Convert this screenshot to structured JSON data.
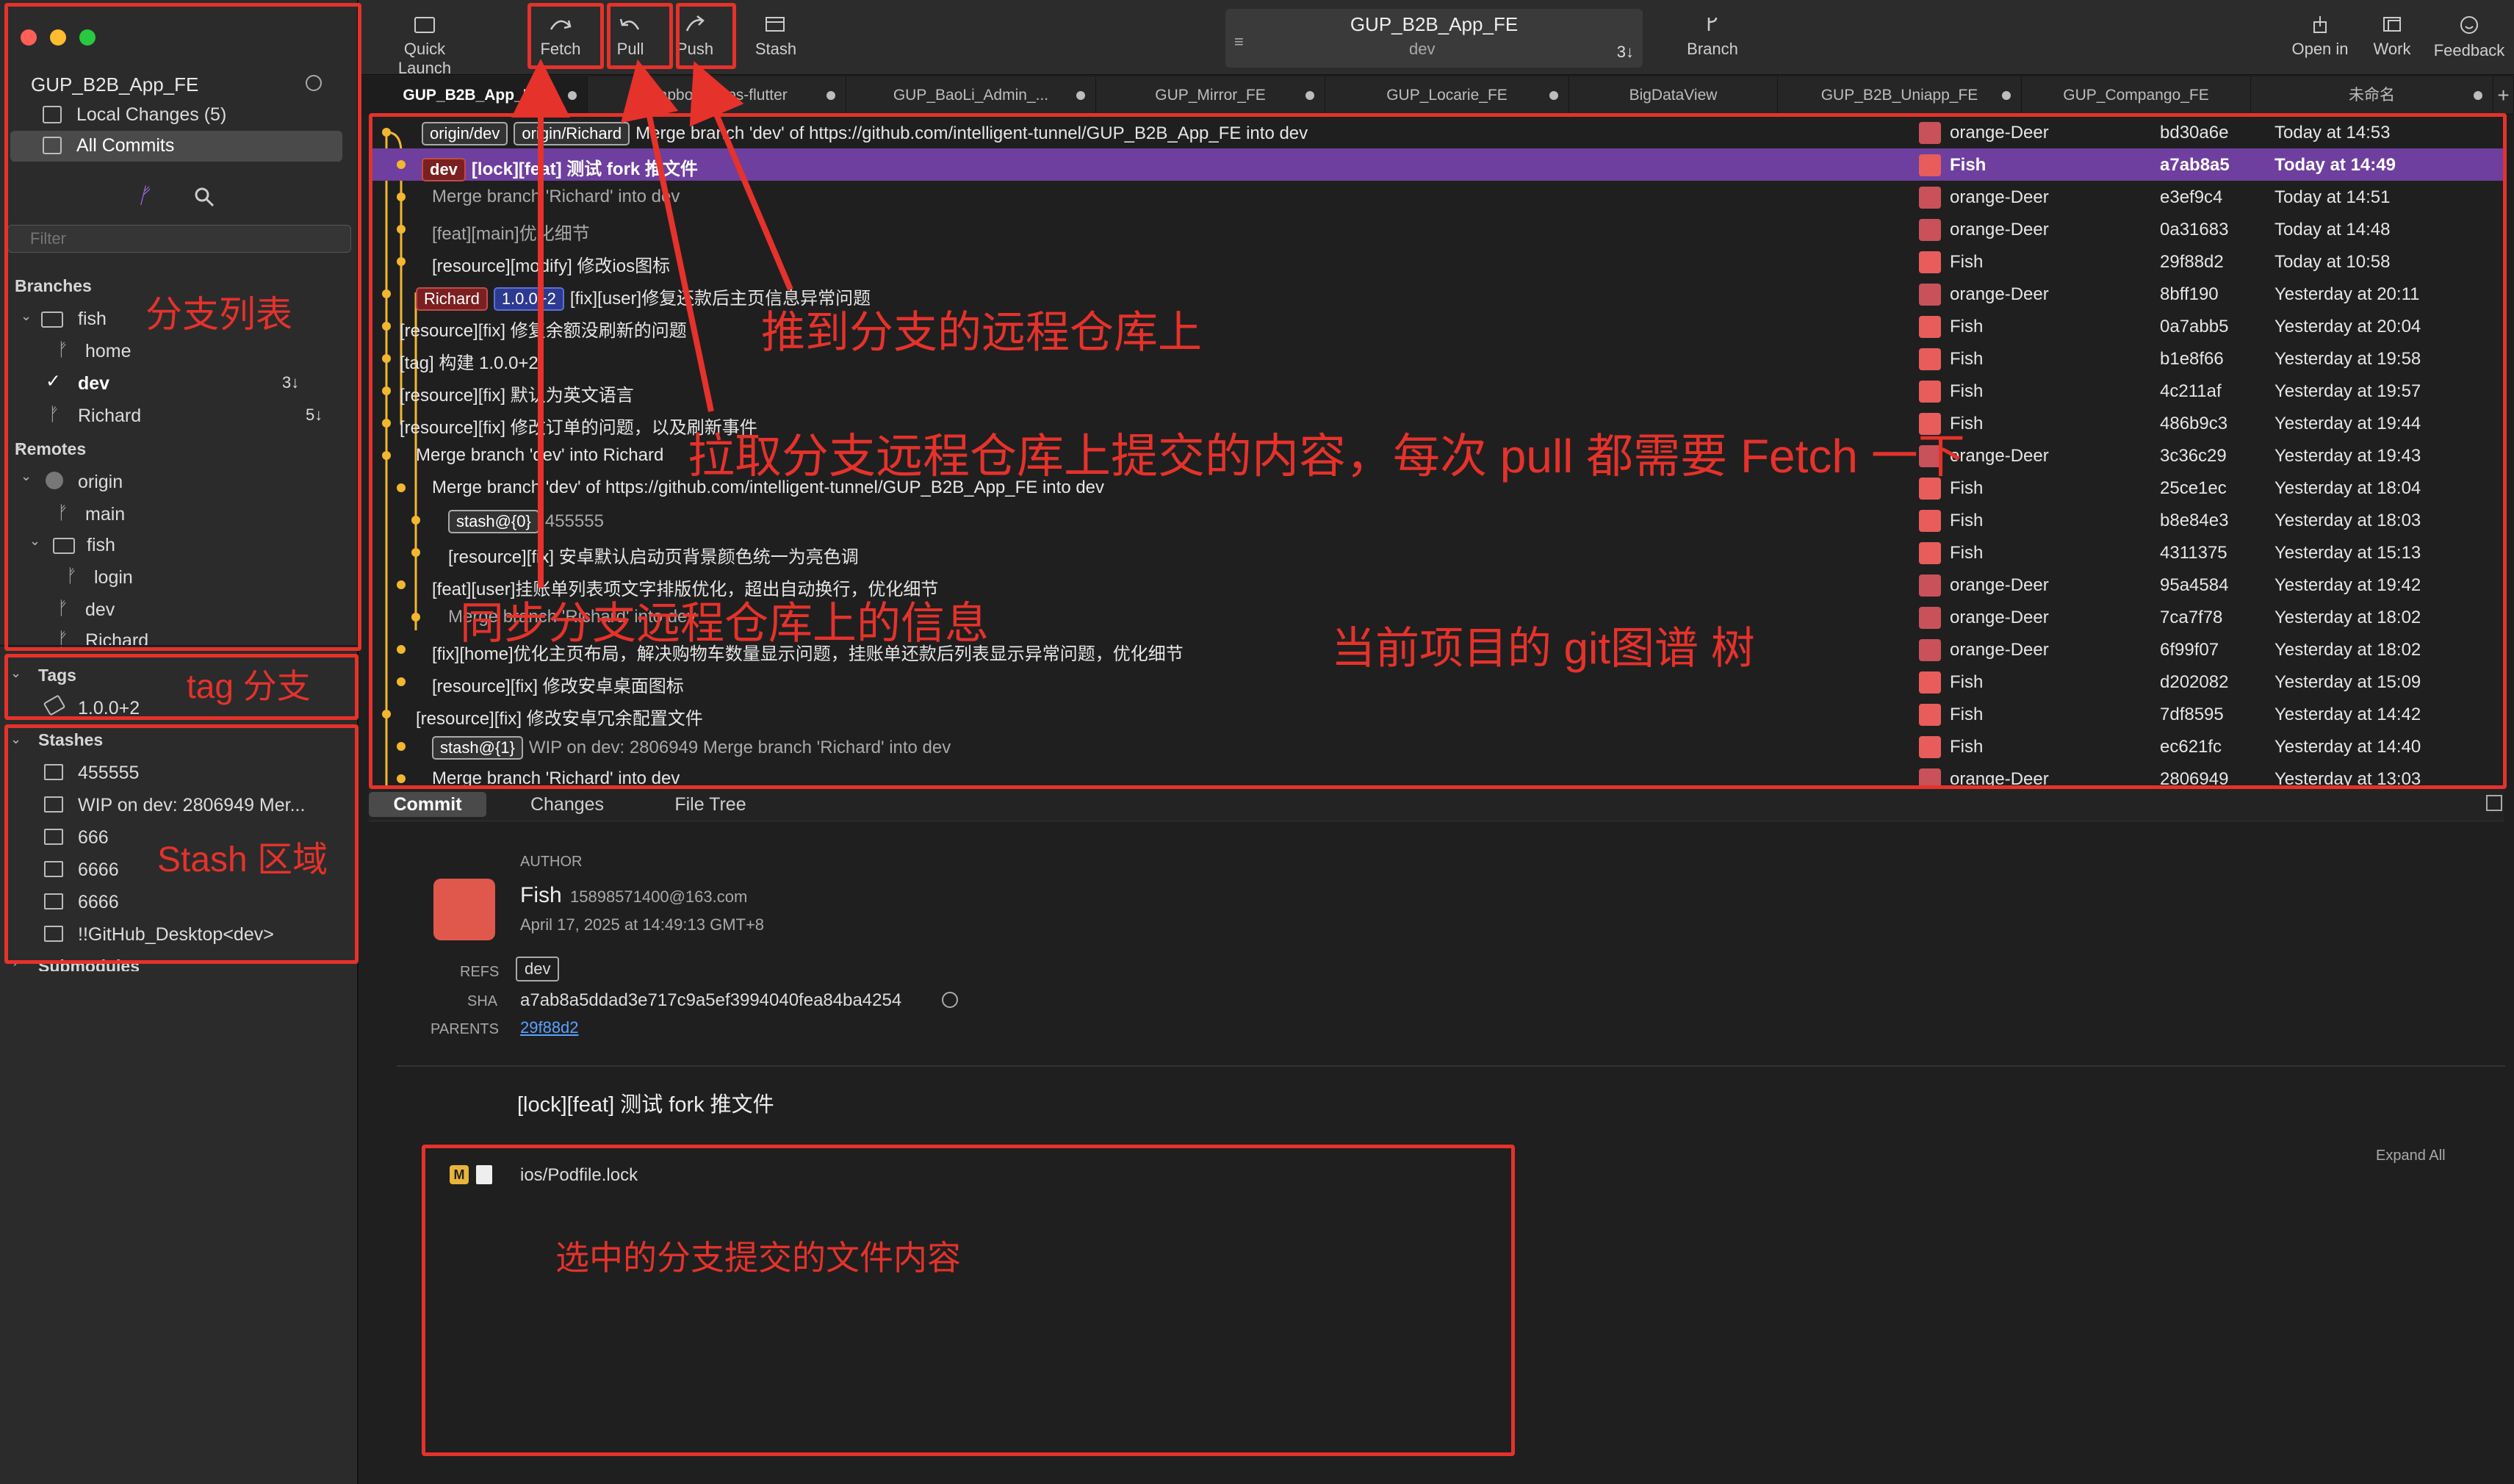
{
  "window": {
    "title": "GUP_B2B_App_FE",
    "branch": "dev",
    "behind": "3↓"
  },
  "toolbar": {
    "quick_launch": "Quick Launch",
    "fetch": "Fetch",
    "pull": "Pull",
    "push": "Push",
    "stash": "Stash",
    "branch": "Branch",
    "open_in": "Open in",
    "work": "Work",
    "feedback": "Feedback"
  },
  "tabs": [
    "GUP_B2B_App_FE",
    "mapbox-maps-flutter",
    "GUP_BaoLi_Admin_...",
    "GUP_Mirror_FE",
    "GUP_Locarie_FE",
    "BigDataView",
    "GUP_B2B_Uniapp_FE",
    "GUP_Compango_FE",
    "未命名"
  ],
  "sidebar": {
    "repo": "GUP_B2B_App_FE",
    "local_changes": "Local Changes (5)",
    "all_commits": "All Commits",
    "filter_placeholder": "Filter",
    "branches_header": "Branches",
    "branches": {
      "folder": "fish",
      "home": "home",
      "dev": "dev",
      "dev_count": "3↓",
      "richard": "Richard",
      "richard_count": "5↓"
    },
    "remotes_header": "Remotes",
    "remotes": {
      "origin": "origin",
      "main": "main",
      "fish": "fish",
      "login": "login",
      "dev": "dev",
      "richard": "Richard"
    },
    "tags_header": "Tags",
    "tags": [
      "1.0.0+2"
    ],
    "stashes_header": "Stashes",
    "stashes": [
      "455555",
      "WIP on dev: 2806949 Mer...",
      "666",
      "6666",
      "6666",
      "!!GitHub_Desktop<dev>"
    ],
    "submodules_header": "Submodules"
  },
  "commits": [
    {
      "refs": [
        "origin/dev",
        "origin/Richard"
      ],
      "message": "Merge branch 'dev' of https://github.com/intelligent-tunnel/GUP_B2B_App_FE into dev",
      "author": "orange-Deer",
      "sha": "bd30a6e",
      "date": "Today at 14:53"
    },
    {
      "refs": [
        "dev"
      ],
      "message": "[lock][feat] 测试 fork 推文件",
      "author": "Fish",
      "sha": "a7ab8a5",
      "date": "Today at 14:49"
    },
    {
      "message": "Merge branch 'Richard' into dev",
      "author": "orange-Deer",
      "sha": "e3ef9c4",
      "date": "Today at 14:51"
    },
    {
      "message": "[feat][main]优化细节",
      "author": "orange-Deer",
      "sha": "0a31683",
      "date": "Today at 14:48"
    },
    {
      "message": "[resource][modify] 修改ios图标",
      "author": "Fish",
      "sha": "29f88d2",
      "date": "Today at 10:58"
    },
    {
      "refs": [
        "Richard",
        "1.0.0+2"
      ],
      "message": "[fix][user]修复还款后主页信息异常问题",
      "author": "orange-Deer",
      "sha": "8bff190",
      "date": "Yesterday at 20:11"
    },
    {
      "message": "[resource][fix] 修复余额没刷新的问题",
      "author": "Fish",
      "sha": "0a7abb5",
      "date": "Yesterday at 20:04"
    },
    {
      "message": "[tag] 构建 1.0.0+2",
      "author": "Fish",
      "sha": "b1e8f66",
      "date": "Yesterday at 19:58"
    },
    {
      "message": "[resource][fix] 默认为英文语言",
      "author": "Fish",
      "sha": "4c211af",
      "date": "Yesterday at 19:57"
    },
    {
      "message": "[resource][fix] 修改订单的问题，以及刷新事件",
      "author": "Fish",
      "sha": "486b9c3",
      "date": "Yesterday at 19:44"
    },
    {
      "message": "Merge branch 'dev' into Richard",
      "author": "orange-Deer",
      "sha": "3c36c29",
      "date": "Yesterday at 19:43"
    },
    {
      "message": "Merge branch 'dev' of https://github.com/intelligent-tunnel/GUP_B2B_App_FE into dev",
      "author": "Fish",
      "sha": "25ce1ec",
      "date": "Yesterday at 18:04"
    },
    {
      "refs": [
        "stash@{0}"
      ],
      "message": "455555",
      "author": "Fish",
      "sha": "b8e84e3",
      "date": "Yesterday at 18:03"
    },
    {
      "message": "[resource][fix] 安卓默认启动页背景颜色统一为亮色调",
      "author": "Fish",
      "sha": "4311375",
      "date": "Yesterday at 15:13"
    },
    {
      "message": "[feat][user]挂账单列表项文字排版优化，超出自动换行，优化细节",
      "author": "orange-Deer",
      "sha": "95a4584",
      "date": "Yesterday at 19:42"
    },
    {
      "message": "Merge branch 'Richard' into dev",
      "author": "orange-Deer",
      "sha": "7ca7f78",
      "date": "Yesterday at 18:02"
    },
    {
      "message": "[fix][home]优化主页布局，解决购物车数量显示问题，挂账单还款后列表显示异常问题，优化细节",
      "author": "orange-Deer",
      "sha": "6f99f07",
      "date": "Yesterday at 18:02"
    },
    {
      "message": "[resource][fix] 修改安卓桌面图标",
      "author": "Fish",
      "sha": "d202082",
      "date": "Yesterday at 15:09"
    },
    {
      "message": "[resource][fix] 修改安卓冗余配置文件",
      "author": "Fish",
      "sha": "7df8595",
      "date": "Yesterday at 14:42"
    },
    {
      "refs": [
        "stash@{1}"
      ],
      "message": "WIP on dev: 2806949 Merge branch 'Richard' into dev",
      "author": "Fish",
      "sha": "ec621fc",
      "date": "Yesterday at 14:40"
    },
    {
      "message": "Merge branch 'Richard' into dev",
      "author": "orange-Deer",
      "sha": "2806949",
      "date": "Yesterday at 13:03"
    }
  ],
  "detail_tabs": [
    "Commit",
    "Changes",
    "File Tree"
  ],
  "details": {
    "author_label": "AUTHOR",
    "author_name": "Fish",
    "author_email": "15898571400@163.com",
    "author_date": "April 17, 2025 at 14:49:13 GMT+8",
    "refs_label": "REFS",
    "refs_value": "dev",
    "sha_label": "SHA",
    "sha_value": "a7ab8a5ddad3e717c9a5ef3994040fea84ba4254",
    "parents_label": "PARENTS",
    "parents_value": "29f88d2",
    "subject": "[lock][feat] 测试 fork 推文件",
    "expand_all": "Expand All",
    "file": "ios/Podfile.lock",
    "file_status": "M"
  },
  "annotations": {
    "branch_list": "分支列表",
    "tag_branch": "tag 分支",
    "stash_area": "Stash 区域",
    "push_note": "推到分支的远程仓库上",
    "pull_note": "拉取分支远程仓库上提交的内容，每次 pull 都需要 Fetch 一下",
    "fetch_note": "同步分支远程仓库上的信息",
    "graph_note": "当前项目的 git图谱 树",
    "files_note": "选中的分支提交的文件内容"
  },
  "colors": {
    "annotation": "#e5322b",
    "selected_row": "#6e3f9e",
    "graph_line": "#f2b72f"
  }
}
